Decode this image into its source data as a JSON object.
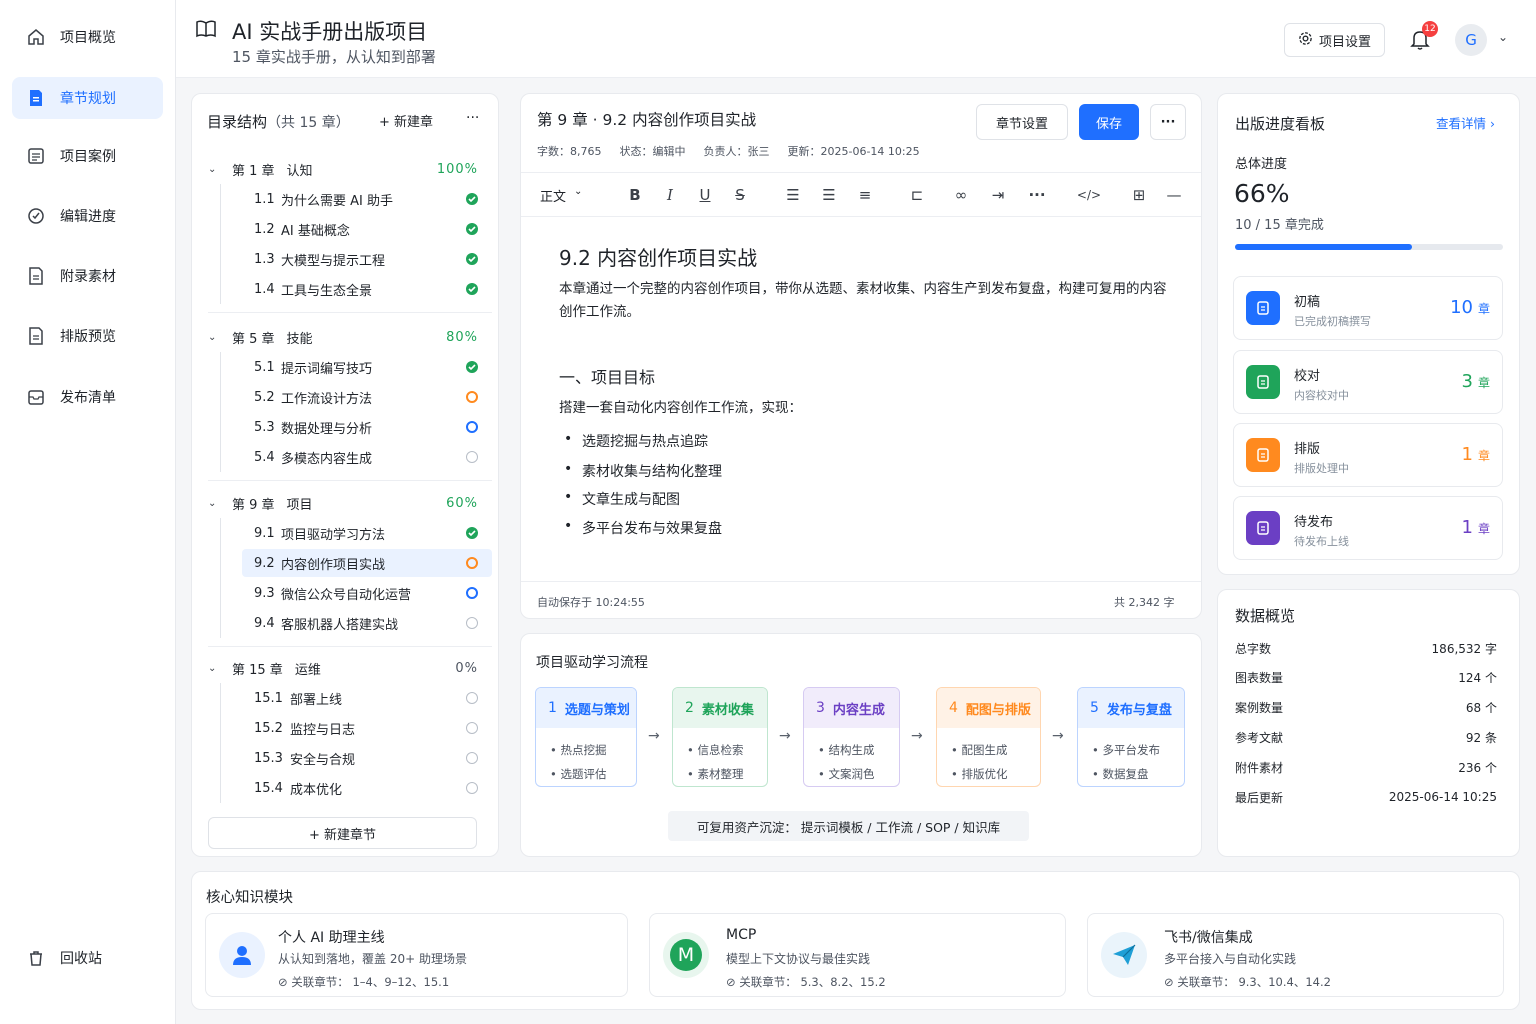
{
  "sidebar": {
    "items": [
      {
        "label": "项目概览"
      },
      {
        "label": "章节规划"
      },
      {
        "label": "项目案例"
      },
      {
        "label": "编辑进度"
      },
      {
        "label": "附录素材"
      },
      {
        "label": "排版预览"
      },
      {
        "label": "发布清单"
      }
    ],
    "recycle": "回收站"
  },
  "header": {
    "title": "AI 实战手册出版项目",
    "subtitle": "15 章实战手册，从认知到部署",
    "settings_label": "项目设置",
    "notif_count": "12",
    "avatar": "G"
  },
  "toc": {
    "title": "目录结构",
    "count": "（共 15 章）",
    "new_chapter": "+ 新建章",
    "more": "···",
    "chapters": [
      {
        "num": "第 1 章",
        "name": "认知",
        "pct": "100%",
        "sections": [
          {
            "num": "1.1",
            "name": "为什么需要 AI 助手"
          },
          {
            "num": "1.2",
            "name": "AI 基础概念"
          },
          {
            "num": "1.3",
            "name": "大模型与提示工程"
          },
          {
            "num": "1.4",
            "name": "工具与生态全景"
          }
        ]
      },
      {
        "num": "第 5 章",
        "name": "技能",
        "pct": "80%",
        "sections": [
          {
            "num": "5.1",
            "name": "提示词编写技巧"
          },
          {
            "num": "5.2",
            "name": "工作流设计方法"
          },
          {
            "num": "5.3",
            "name": "数据处理与分析"
          },
          {
            "num": "5.4",
            "name": "多模态内容生成"
          }
        ]
      },
      {
        "num": "第 9 章",
        "name": "项目",
        "pct": "60%",
        "sections": [
          {
            "num": "9.1",
            "name": "项目驱动学习方法"
          },
          {
            "num": "9.2",
            "name": "内容创作项目实战"
          },
          {
            "num": "9.3",
            "name": "微信公众号自动化运营"
          },
          {
            "num": "9.4",
            "name": "客服机器人搭建实战"
          }
        ]
      },
      {
        "num": "第 15 章",
        "name": "运维",
        "pct": "0%",
        "sections": [
          {
            "num": "15.1",
            "name": "部署上线"
          },
          {
            "num": "15.2",
            "name": "监控与日志"
          },
          {
            "num": "15.3",
            "name": "安全与合规"
          },
          {
            "num": "15.4",
            "name": "成本优化"
          }
        ]
      }
    ],
    "new_section": "+ 新建章节"
  },
  "editor": {
    "title": "第 9 章 · 9.2 内容创作项目实战",
    "meta": {
      "words_label": "字数：",
      "words": "8,765",
      "status_label": "状态：",
      "status": "编辑中",
      "owner_label": "负责人：",
      "owner": "张三",
      "updated_label": "更新：",
      "updated": "2025-06-14 10:25"
    },
    "chapter_settings": "章节设置",
    "save": "保存",
    "more": "···",
    "format": "正文",
    "h1": "9.2 内容创作项目实战",
    "intro": "本章通过一个完整的内容创作项目，带你从选题、素材收集、内容生产到发布复盘，构建可复用的内容创作工作流。",
    "h2": "一、项目目标",
    "p2": "搭建一套自动化内容创作工作流，实现：",
    "bullets": [
      "选题挖掘与热点追踪",
      "素材收集与结构化整理",
      "文章生成与配图",
      "多平台发布与效果复盘"
    ],
    "autosave": "自动保存于 10:24:55",
    "total": "共 2,342 字"
  },
  "flow": {
    "title": "项目驱动学习流程",
    "steps": [
      {
        "num": "1",
        "name": "选题与策划",
        "items": [
          "热点挖掘",
          "选题评估"
        ]
      },
      {
        "num": "2",
        "name": "素材收集",
        "items": [
          "信息检索",
          "素材整理"
        ]
      },
      {
        "num": "3",
        "name": "内容生成",
        "items": [
          "结构生成",
          "文案润色"
        ]
      },
      {
        "num": "4",
        "name": "配图与排版",
        "items": [
          "配图生成",
          "排版优化"
        ]
      },
      {
        "num": "5",
        "name": "发布与复盘",
        "items": [
          "多平台发布",
          "数据复盘"
        ]
      }
    ],
    "reuse": "可复用资产沉淀：  提示词模板 / 工作流 / SOP / 知识库",
    "colors": [
      "#1f6fff",
      "#1fa45a",
      "#6b3fc4",
      "#ff8a1f",
      "#1f6fff"
    ]
  },
  "progress": {
    "title": "出版进度看板",
    "detail": "查看详情",
    "total_label": "总体进度",
    "pct": "66%",
    "value": 0.66,
    "done": "10 / 15 章完成",
    "stats": [
      {
        "name": "初稿",
        "desc": "已完成初稿撰写",
        "count": "10",
        "unit": "章",
        "color": "#1f6fff"
      },
      {
        "name": "校对",
        "desc": "内容校对中",
        "count": "3",
        "unit": "章",
        "color": "#1fa45a"
      },
      {
        "name": "排版",
        "desc": "排版处理中",
        "count": "1",
        "unit": "章",
        "color": "#ff8a1f"
      },
      {
        "name": "待发布",
        "desc": "待发布上线",
        "count": "1",
        "unit": "章",
        "color": "#6b3fc4"
      }
    ]
  },
  "overview": {
    "title": "数据概览",
    "rows": [
      {
        "k": "总字数",
        "v": "186,532 字"
      },
      {
        "k": "图表数量",
        "v": "124 个"
      },
      {
        "k": "案例数量",
        "v": "68 个"
      },
      {
        "k": "参考文献",
        "v": "92 条"
      },
      {
        "k": "附件素材",
        "v": "236 个"
      },
      {
        "k": "最后更新",
        "v": "2025-06-14 10:25"
      }
    ]
  },
  "modules": {
    "title": "核心知识模块",
    "items": [
      {
        "name": "个人 AI 助理主线",
        "desc": "从认知到落地，覆盖 20+ 助理场景",
        "rel_label": "关联章节：",
        "rel": "1–4、9–12、15.1"
      },
      {
        "name": "MCP",
        "desc": "模型上下文协议与最佳实践",
        "rel_label": "关联章节：",
        "rel": "5.3、8.2、15.2",
        "badge": "M"
      },
      {
        "name": "飞书/微信集成",
        "desc": "多平台接入与自动化实践",
        "rel_label": "关联章节：",
        "rel": "9.3、10.4、14.2"
      }
    ]
  }
}
